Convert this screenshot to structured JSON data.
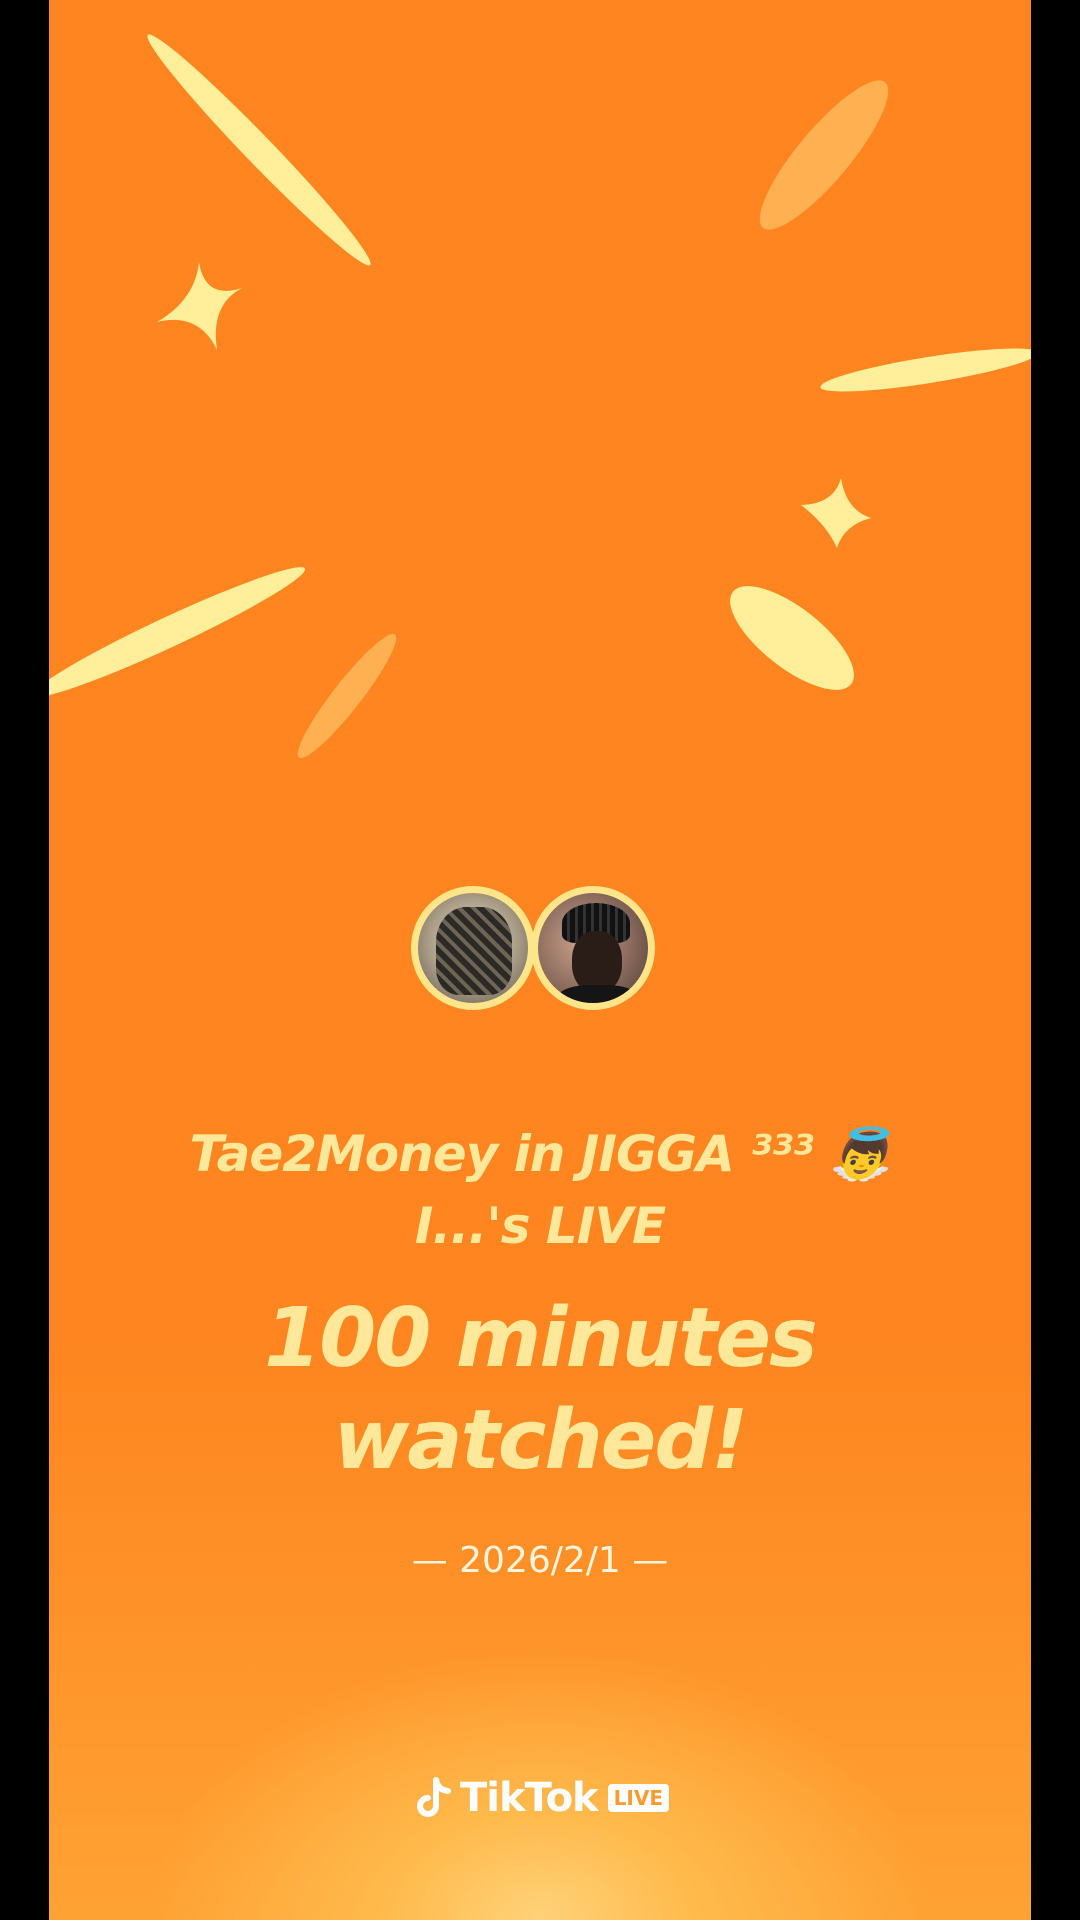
{
  "card": {
    "title_line1": "Tae2Money in JIGGA ³³³ 👼",
    "title_line2": "I...'s LIVE",
    "minutes_line1": "100 minutes",
    "minutes_line2": "watched!",
    "date": "— 2026/2/1 —"
  },
  "avatars": [
    {
      "name": "avatar-1"
    },
    {
      "name": "avatar-2"
    }
  ],
  "brand": {
    "icon": "tiktok-note-icon",
    "name": "TikTok",
    "badge": "LIVE"
  },
  "colors": {
    "background": "#fe851f",
    "accent_text": "#ffe89a",
    "decor_light": "#ffef9a",
    "decor_faded": "#ffb050",
    "date_text": "#fff4dc"
  }
}
